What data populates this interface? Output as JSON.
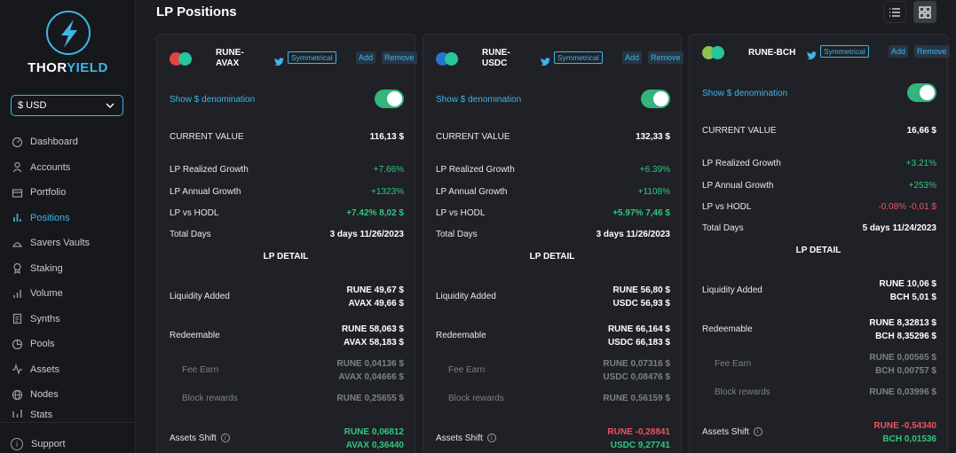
{
  "brand": {
    "part1": "THOR",
    "part2": "YIELD"
  },
  "currency": {
    "selected": "$ USD"
  },
  "nav": [
    {
      "label": "Dashboard",
      "icon": "dashboard-icon"
    },
    {
      "label": "Accounts",
      "icon": "user-icon"
    },
    {
      "label": "Portfolio",
      "icon": "portfolio-icon"
    },
    {
      "label": "Positions",
      "icon": "bar-chart-icon",
      "active": true
    },
    {
      "label": "Savers Vaults",
      "icon": "vault-icon"
    },
    {
      "label": "Staking",
      "icon": "staking-icon"
    },
    {
      "label": "Volume",
      "icon": "volume-icon"
    },
    {
      "label": "Synths",
      "icon": "synths-icon"
    },
    {
      "label": "Pools",
      "icon": "pie-icon"
    },
    {
      "label": "Assets",
      "icon": "activity-icon"
    },
    {
      "label": "Nodes",
      "icon": "globe-icon"
    },
    {
      "label": "Stats",
      "icon": "stats-icon"
    }
  ],
  "support": {
    "label": "Support",
    "icon_glyph": "i"
  },
  "page": {
    "title": "LP Positions"
  },
  "labels": {
    "symmetrical": "Symmetrical",
    "add": "Add",
    "remove": "Remove",
    "show_denom": "Show $ denomination",
    "current_value": "CURRENT VALUE",
    "lp_realized": "LP Realized Growth",
    "lp_annual": "LP Annual Growth",
    "lp_vs_hodl": "LP vs HODL",
    "total_days": "Total Days",
    "lp_detail": "LP DETAIL",
    "liquidity_added": "Liquidity Added",
    "redeemable": "Redeemable",
    "fee_earn": "Fee Earn",
    "block_rewards": "Block rewards",
    "assets_shift": "Assets Shift"
  },
  "cards": [
    {
      "pair_line1": "RUNE-",
      "pair_line2": "AVAX",
      "coin_color": "#e84142",
      "current_value": "116,13 $",
      "lp_realized": "+7.66%",
      "lp_annual": "+1323%",
      "lp_vs_hodl": "+7.42% 8,02 $",
      "hodl_state": "bgreen",
      "total_days": "3 days 11/26/2023",
      "liq_added_1": "RUNE 49,67 $",
      "liq_added_2": "AVAX 49,66 $",
      "redeem_1": "RUNE 58,063 $",
      "redeem_2": "AVAX 58,183 $",
      "fee_1": "RUNE 0,04136 $",
      "fee_2": "AVAX 0,04666 $",
      "block_rewards": "RUNE 0,25655 $",
      "shift_1": "RUNE 0,06812",
      "shift_2": "AVAX 0,36440",
      "shift_1_state": "bgreen",
      "shift_2_state": "bgreen"
    },
    {
      "pair_line1": "RUNE-",
      "pair_line2": "USDC",
      "coin_color": "#2775ca",
      "current_value": "132,33 $",
      "lp_realized": "+6.39%",
      "lp_annual": "+1108%",
      "lp_vs_hodl": "+5.97% 7,46 $",
      "hodl_state": "bgreen",
      "total_days": "3 days 11/26/2023",
      "liq_added_1": "RUNE 56,80 $",
      "liq_added_2": "USDC 56,93 $",
      "redeem_1": "RUNE 66,164 $",
      "redeem_2": "USDC 66,183 $",
      "fee_1": "RUNE 0,07316 $",
      "fee_2": "USDC 0,08476 $",
      "block_rewards": "RUNE 0,56159 $",
      "shift_1": "RUNE -0,28841",
      "shift_2": "USDC 9,27741",
      "shift_1_state": "bred",
      "shift_2_state": "bgreen"
    },
    {
      "pair_line1": "RUNE-BCH",
      "pair_line2": "",
      "coin_color": "#8dc351",
      "current_value": "16,66 $",
      "lp_realized": "+3.21%",
      "lp_annual": "+253%",
      "lp_vs_hodl": "-0.08% -0,01 $",
      "hodl_state": "red",
      "total_days": "5 days 11/24/2023",
      "liq_added_1": "RUNE 10,06 $",
      "liq_added_2": "BCH 5,01 $",
      "redeem_1": "RUNE 8,32813 $",
      "redeem_2": "BCH 8,35296 $",
      "fee_1": "RUNE 0,00565 $",
      "fee_2": "BCH 0,00757 $",
      "block_rewards": "RUNE 0,03996 $",
      "shift_1": "RUNE -0,54340",
      "shift_2": "BCH 0,01536",
      "shift_1_state": "bred",
      "shift_2_state": "bgreen"
    }
  ]
}
